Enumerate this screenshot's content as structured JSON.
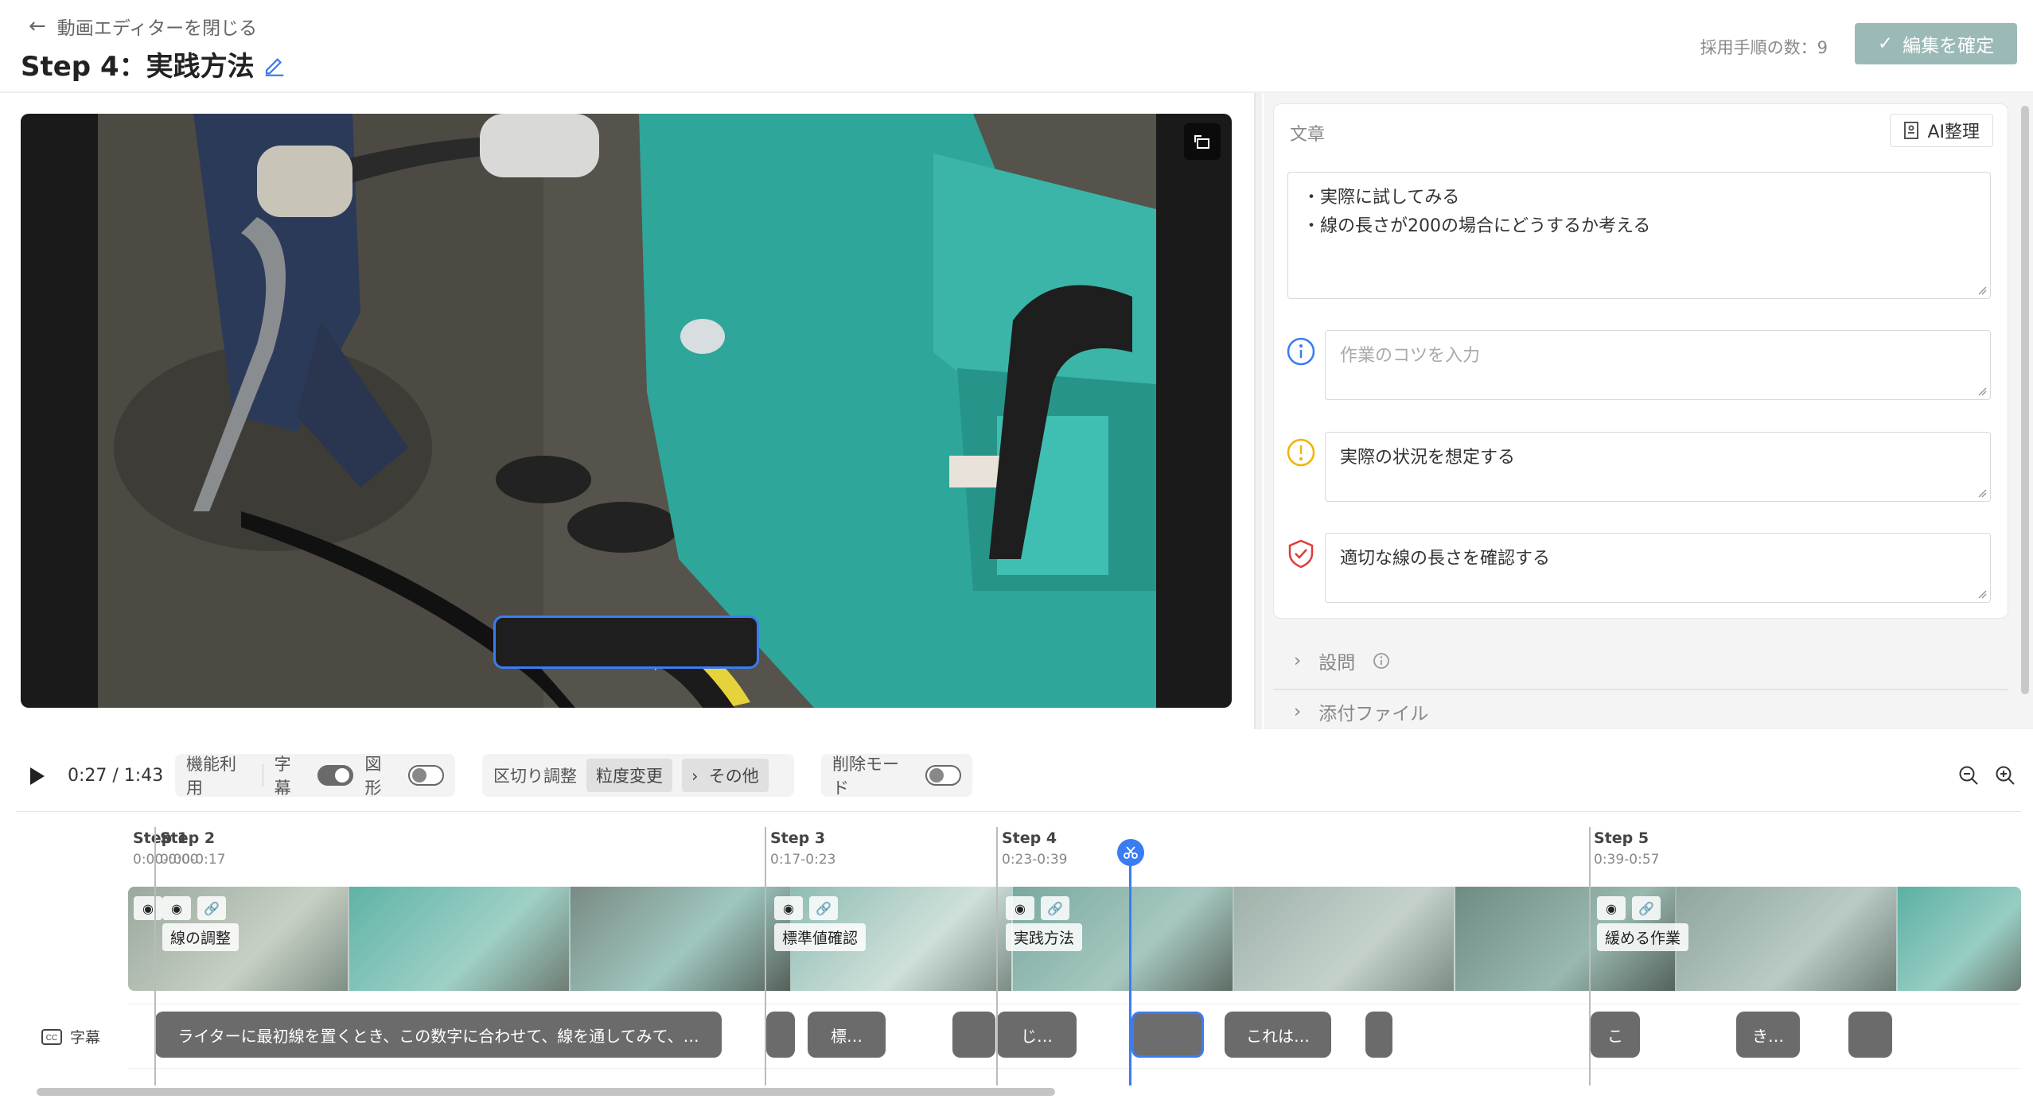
{
  "header": {
    "back_label": "動画エディターを閉じる",
    "title": "Step 4：実践方法",
    "step_count": "採用手順の数：9",
    "confirm_label": "編集を確定"
  },
  "panel": {
    "text_label": "文章",
    "ai_label": "AI整理",
    "text_value_line1": "・実際に試してみる",
    "text_value_line2": "・線の長さが200の場合にどうするか考える",
    "tip_placeholder": "作業のコツを入力",
    "caution_value": "実際の状況を想定する",
    "safety_value": "適切な線の長さを確認する",
    "question_label": "設問",
    "attachment_label": "添付ファイル"
  },
  "controls": {
    "time": "0:27 / 1:43",
    "feature_label": "機能利用",
    "subtitle_toggle_label": "字幕",
    "shape_toggle_label": "図形",
    "split_label": "区切り調整",
    "granularity_label": "粒度変更",
    "other_label": "その他",
    "delete_mode_label": "削除モード"
  },
  "timeline": {
    "subtitle_track_label": "字幕",
    "steps": [
      {
        "name": "Step 1",
        "time": "0:00-0:00"
      },
      {
        "name": "Step 2",
        "time": "0:00-0:17"
      },
      {
        "name": "Step 3",
        "time": "0:17-0:23"
      },
      {
        "name": "Step 4",
        "time": "0:23-0:39"
      },
      {
        "name": "Step 5",
        "time": "0:39-0:57"
      }
    ],
    "clip_labels": [
      "線の調整",
      "標準値確認",
      "実践方法",
      "緩める作業"
    ],
    "subtitles": [
      "ライターに最初線を置くとき、この数字に合わせて、線を通してみて、…",
      "標…",
      "じ…",
      "これは…",
      "こ",
      "き…"
    ]
  },
  "colors": {
    "accent": "#3b7cf2",
    "confirm_bg": "#9bb9b7",
    "tip_icon": "#3b7cf2",
    "caution_icon": "#f0b400",
    "safety_icon": "#e03b3b"
  }
}
